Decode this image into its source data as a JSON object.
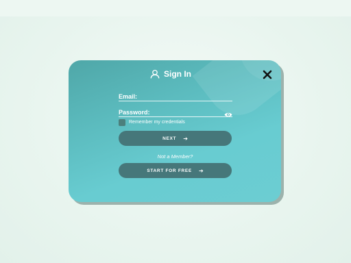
{
  "dialog": {
    "title": "Sign In",
    "email": {
      "label": "Email:",
      "value": ""
    },
    "password": {
      "label": "Password:",
      "value": ""
    },
    "remember": {
      "label": "Remember my credentials",
      "checked": false
    },
    "next_button": {
      "label": "NEXT",
      "arrow": "➔"
    },
    "not_member": "Not a Member?",
    "start_button": {
      "label": "START FOR FREE",
      "arrow": "➔"
    },
    "icons": {
      "header": "user-icon",
      "close": "close-icon",
      "reveal": "eye-icon"
    }
  },
  "colors": {
    "card_start": "#4fa7a8",
    "card_end": "#6ccdd2",
    "button": "#46777a",
    "checkbox": "#4c7f7c",
    "background": "#e9f5ef"
  }
}
